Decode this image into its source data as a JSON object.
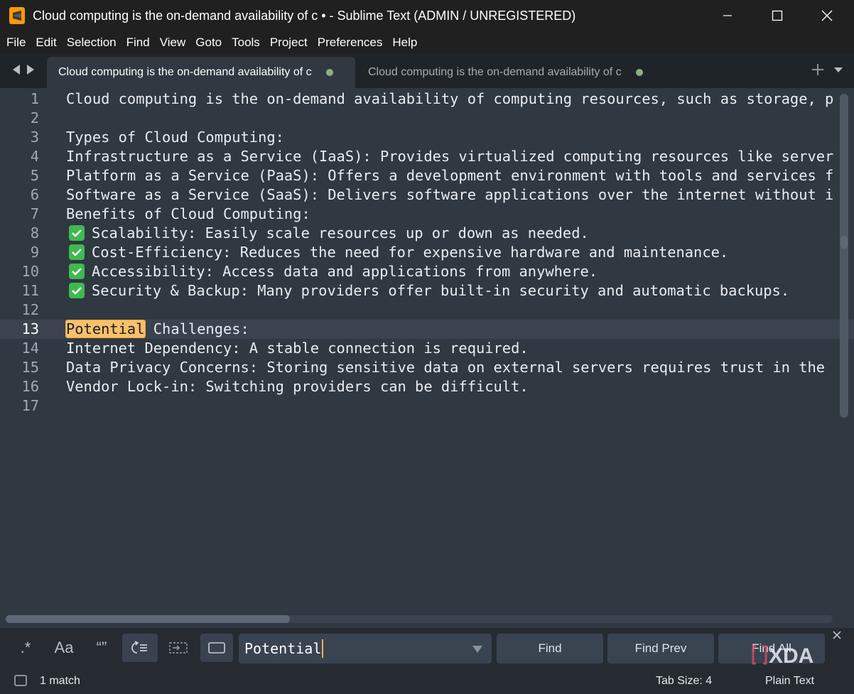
{
  "window": {
    "title": "Cloud computing is the on-demand availability of c • - Sublime Text (ADMIN / UNREGISTERED)"
  },
  "menu": [
    "File",
    "Edit",
    "Selection",
    "Find",
    "View",
    "Goto",
    "Tools",
    "Project",
    "Preferences",
    "Help"
  ],
  "tabs": [
    {
      "label": "Cloud computing is the on-demand availability of c",
      "active": true
    },
    {
      "label": "Cloud computing is the on-demand availability of c",
      "active": false
    }
  ],
  "editor": {
    "current_line": 13,
    "lines": [
      {
        "n": "1",
        "text": "Cloud computing is the on-demand availability of computing resources, such as storage, p"
      },
      {
        "n": "2",
        "text": ""
      },
      {
        "n": "3",
        "text": "Types of Cloud Computing:"
      },
      {
        "n": "4",
        "text": "Infrastructure as a Service (IaaS): Provides virtualized computing resources like server"
      },
      {
        "n": "5",
        "text": "Platform as a Service (PaaS): Offers a development environment with tools and services f"
      },
      {
        "n": "6",
        "text": "Software as a Service (SaaS): Delivers software applications over the internet without i"
      },
      {
        "n": "7",
        "text": "Benefits of Cloud Computing:"
      },
      {
        "n": "8",
        "check": true,
        "text": "Scalability: Easily scale resources up or down as needed."
      },
      {
        "n": "9",
        "check": true,
        "text": "Cost-Efficiency: Reduces the need for expensive hardware and maintenance."
      },
      {
        "n": "10",
        "check": true,
        "text": "Accessibility: Access data and applications from anywhere."
      },
      {
        "n": "11",
        "check": true,
        "text": "Security & Backup: Many providers offer built-in security and automatic backups."
      },
      {
        "n": "12",
        "text": ""
      },
      {
        "n": "13",
        "highlight": "Potential",
        "text": " Challenges:"
      },
      {
        "n": "14",
        "text": "Internet Dependency: A stable connection is required."
      },
      {
        "n": "15",
        "text": "Data Privacy Concerns: Storing sensitive data on external servers requires trust in the"
      },
      {
        "n": "16",
        "text": "Vendor Lock-in: Switching providers can be difficult."
      },
      {
        "n": "17",
        "text": ""
      }
    ]
  },
  "find_panel": {
    "regex_label": ".*",
    "case_label": "Aa",
    "whole_word_label": "“”",
    "query": "Potential",
    "find_label": "Find",
    "find_prev_label": "Find Prev",
    "find_all_label": "Find All"
  },
  "status": {
    "matches": "1 match",
    "tab_size": "Tab Size: 4",
    "syntax": "Plain Text"
  },
  "watermark": "XDA",
  "colors": {
    "editor_bg": "#303841",
    "highlight": "#f9c06c",
    "check": "#3fb950",
    "title_bar": "#202020"
  }
}
